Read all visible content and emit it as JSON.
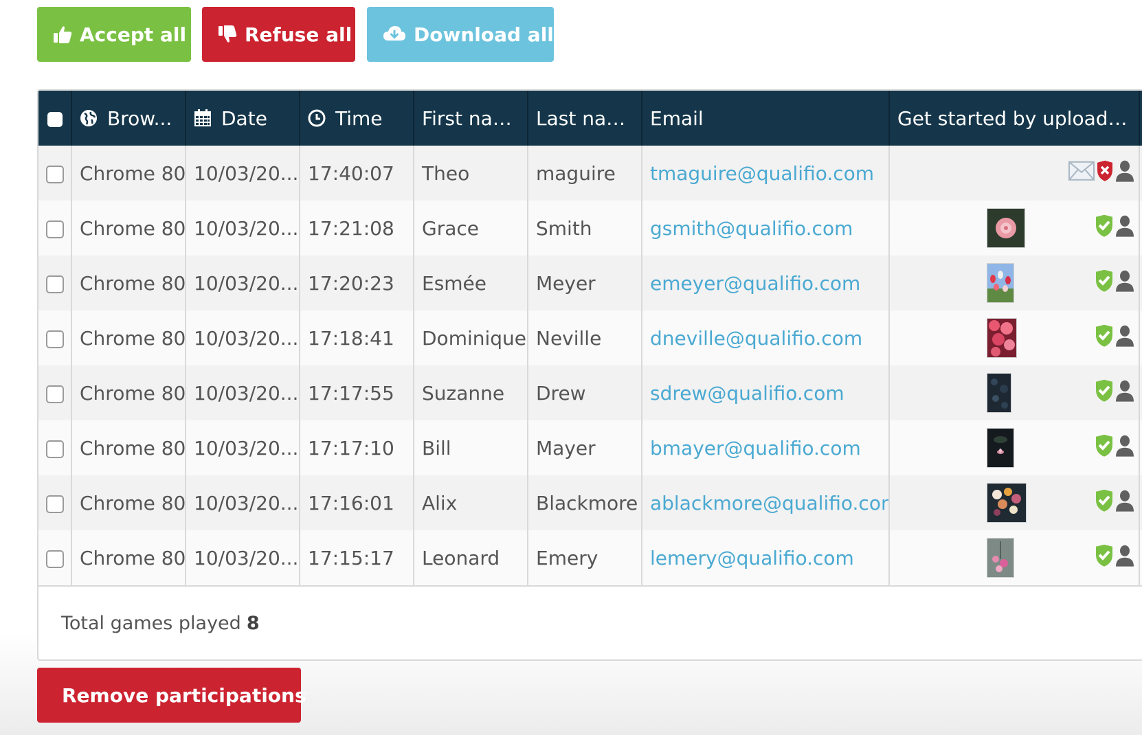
{
  "toolbar": {
    "accept_label": "Accept all",
    "refuse_label": "Refuse all",
    "download_label": "Download all"
  },
  "colors": {
    "accept": "#7ac143",
    "refuse": "#cc2330",
    "download": "#6cc3dd",
    "header_bg": "#15364a",
    "link": "#4aa9d2",
    "valid_shield": "#7ac143",
    "invalid_shield": "#cc2330"
  },
  "table": {
    "headers": {
      "browser": "Brow...",
      "date": "Date",
      "time": "Time",
      "first_name": "First name",
      "last_name": "Last name",
      "email": "Email",
      "upload": "Get started by uploadin..."
    },
    "header_icons": {
      "browser": "globe-icon",
      "date": "calendar-icon",
      "time": "clock-icon"
    },
    "rows": [
      {
        "browser": "Chrome 80",
        "date": "10/03/20...",
        "time": "17:40:07",
        "first_name": "Theo",
        "last_name": "maguire",
        "email": "tmaguire@qualifio.com",
        "upload": "",
        "status": "refused",
        "status_icons": [
          "envelope-icon",
          "shield-x-icon",
          "user-icon"
        ]
      },
      {
        "browser": "Chrome 80",
        "date": "10/03/20...",
        "time": "17:21:08",
        "first_name": "Grace",
        "last_name": "Smith",
        "email": "gsmith@qualifio.com",
        "upload": "rose",
        "status": "accepted",
        "status_icons": [
          "shield-check-icon",
          "user-icon"
        ]
      },
      {
        "browser": "Chrome 80",
        "date": "10/03/20...",
        "time": "17:20:23",
        "first_name": "Esmée",
        "last_name": "Meyer",
        "email": "emeyer@qualifio.com",
        "upload": "tulips",
        "status": "accepted",
        "status_icons": [
          "shield-check-icon",
          "user-icon"
        ]
      },
      {
        "browser": "Chrome 80",
        "date": "10/03/20...",
        "time": "17:18:41",
        "first_name": "Dominique",
        "last_name": "Neville",
        "email": "dneville@qualifio.com",
        "upload": "pink-flowers",
        "status": "accepted",
        "status_icons": [
          "shield-check-icon",
          "user-icon"
        ]
      },
      {
        "browser": "Chrome 80",
        "date": "10/03/20...",
        "time": "17:17:55",
        "first_name": "Suzanne",
        "last_name": "Drew",
        "email": "sdrew@qualifio.com",
        "upload": "dark-leaves",
        "status": "accepted",
        "status_icons": [
          "shield-check-icon",
          "user-icon"
        ]
      },
      {
        "browser": "Chrome 80",
        "date": "10/03/20...",
        "time": "17:17:10",
        "first_name": "Bill",
        "last_name": "Mayer",
        "email": "bmayer@qualifio.com",
        "upload": "lotus",
        "status": "accepted",
        "status_icons": [
          "shield-check-icon",
          "user-icon"
        ]
      },
      {
        "browser": "Chrome 80",
        "date": "10/03/20...",
        "time": "17:16:01",
        "first_name": "Alix",
        "last_name": "Blackmore",
        "email": "ablackmore@qualifio.com",
        "upload": "bouquet",
        "status": "accepted",
        "status_icons": [
          "shield-check-icon",
          "user-icon"
        ]
      },
      {
        "browser": "Chrome 80",
        "date": "10/03/20...",
        "time": "17:15:17",
        "first_name": "Leonard",
        "last_name": "Emery",
        "email": "lemery@qualifio.com",
        "upload": "blossoms",
        "status": "accepted",
        "status_icons": [
          "shield-check-icon",
          "user-icon"
        ]
      }
    ]
  },
  "footer": {
    "total_label": "Total games played",
    "total_value": "8"
  },
  "actions": {
    "remove_label": "Remove participations"
  }
}
